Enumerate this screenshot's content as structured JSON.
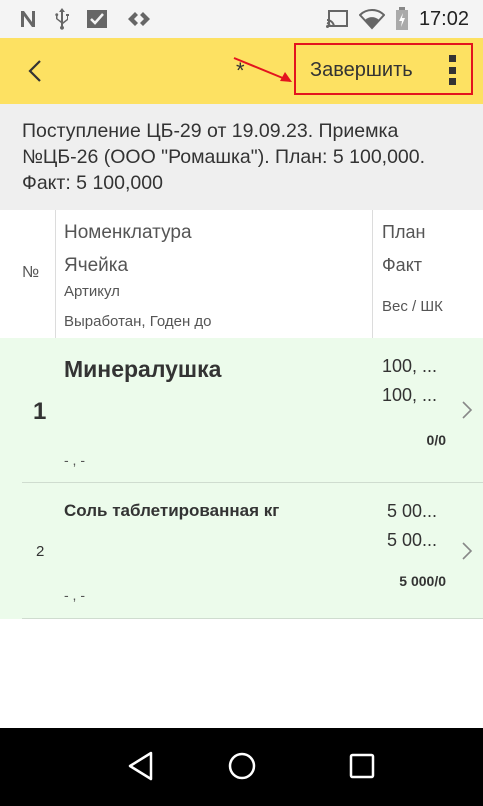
{
  "status_bar": {
    "time": "17:02",
    "left_icons": [
      "n-logo-icon",
      "usb-icon",
      "checkbox-icon",
      "diamond-icon"
    ],
    "right_icons": [
      "cast-icon",
      "wifi-icon",
      "battery-icon"
    ]
  },
  "toolbar": {
    "title": "*",
    "finish_label": "Завершить",
    "highlight_color": "#e3141e",
    "bar_color": "#fde162"
  },
  "document": {
    "line1": "Поступление ЦБ-29 от 19.09.23. Приемка",
    "line2": "№ЦБ-26 (ООО \"Ромашка\"). План: 5 100,000.",
    "line3": "Факт: 5 100,000"
  },
  "columns": {
    "num": "№",
    "nomenclature": "Номенклатура",
    "cell": "Ячейка",
    "article": "Артикул",
    "produced": "Выработан, Годен до",
    "plan": "План",
    "fact": "Факт",
    "weight": "Вес / ШК"
  },
  "rows": [
    {
      "num": "1",
      "name": "Минералушка",
      "dates": "- , -",
      "plan": "100, ...",
      "fact": "100, ...",
      "weight": "0/0"
    },
    {
      "num": "2",
      "name": "Соль таблетированная кг",
      "dates": "- , -",
      "plan": "5 00...",
      "fact": "5 00...",
      "weight": "5 000/0"
    }
  ],
  "row_color": "#ecfbeb"
}
